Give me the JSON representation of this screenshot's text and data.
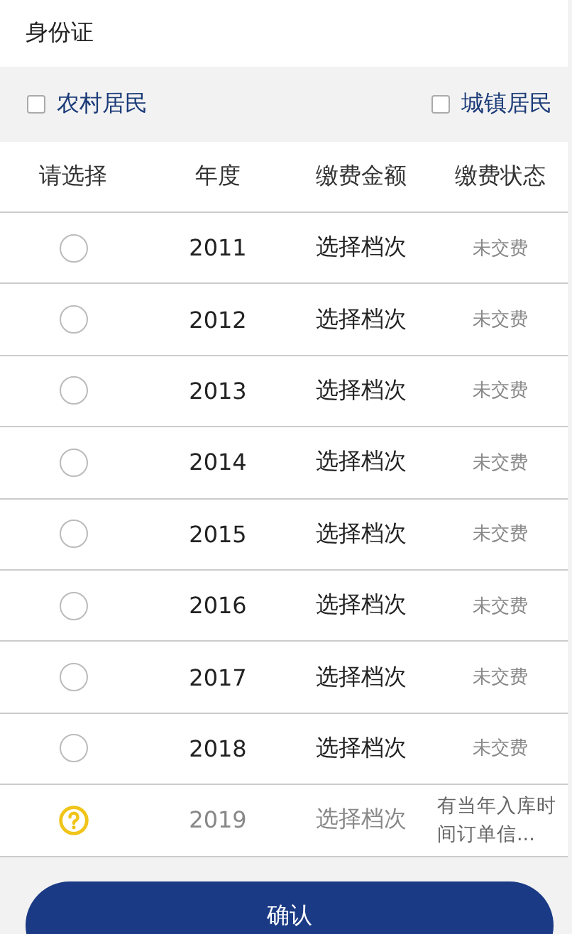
{
  "id_field": {
    "label": "身份证"
  },
  "resident_types": [
    {
      "label": "农村居民",
      "checked": false
    },
    {
      "label": "城镇居民",
      "checked": false
    }
  ],
  "table": {
    "columns": [
      "请选择",
      "年度",
      "缴费金额",
      "缴费状态"
    ],
    "rows": [
      {
        "kind": "radio",
        "selected": false,
        "year": "2011",
        "amount": "选择档次",
        "status": "未交费"
      },
      {
        "kind": "radio",
        "selected": false,
        "year": "2012",
        "amount": "选择档次",
        "status": "未交费"
      },
      {
        "kind": "radio",
        "selected": false,
        "year": "2013",
        "amount": "选择档次",
        "status": "未交费"
      },
      {
        "kind": "radio",
        "selected": false,
        "year": "2014",
        "amount": "选择档次",
        "status": "未交费"
      },
      {
        "kind": "radio",
        "selected": false,
        "year": "2015",
        "amount": "选择档次",
        "status": "未交费"
      },
      {
        "kind": "radio",
        "selected": false,
        "year": "2016",
        "amount": "选择档次",
        "status": "未交费"
      },
      {
        "kind": "radio",
        "selected": false,
        "year": "2017",
        "amount": "选择档次",
        "status": "未交费"
      },
      {
        "kind": "radio",
        "selected": false,
        "year": "2018",
        "amount": "选择档次",
        "status": "未交费"
      },
      {
        "kind": "info",
        "year": "2019",
        "amount": "选择档次",
        "status": "有当年入库时间订单信..."
      }
    ]
  },
  "confirm_button": "确认"
}
